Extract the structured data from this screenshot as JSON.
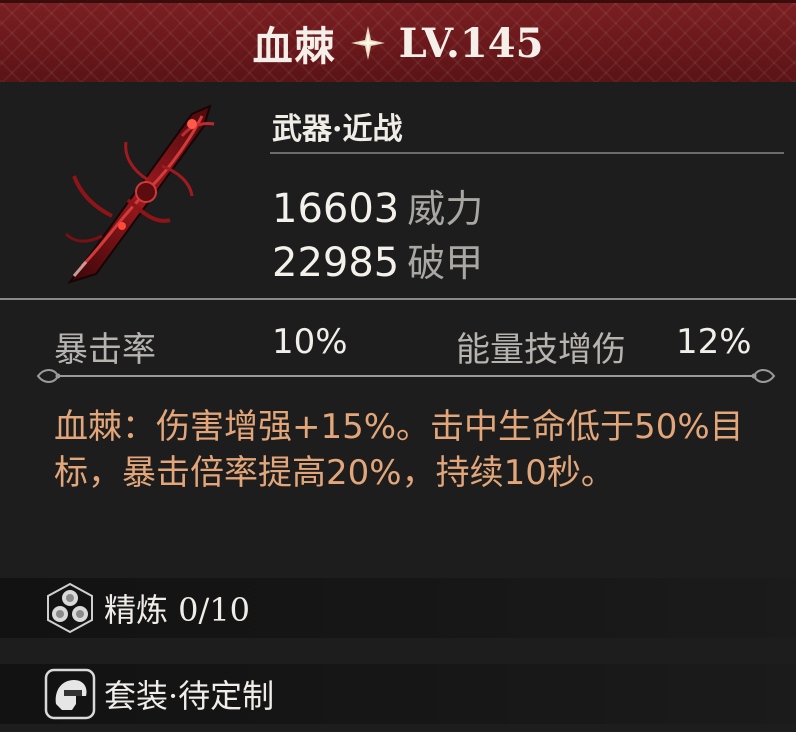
{
  "header": {
    "name": "血棘",
    "star_icon": "four-point-star-icon",
    "level": "LV.145",
    "colors": {
      "banner": "#6a181b"
    }
  },
  "weapon": {
    "image_icon": "crimson-thorn-blade-icon",
    "category": "武器·近战"
  },
  "main_stats": [
    {
      "value": "16603",
      "name": "威力"
    },
    {
      "value": "22985",
      "name": "破甲"
    }
  ],
  "sub_stats": [
    {
      "label": "暴击率",
      "value": "10%"
    },
    {
      "label": "能量技增伤",
      "value": "12%"
    }
  ],
  "description": "血棘：伤害增强+15%。击中生命低于50%目标，暴击倍率提高20%，持续10秒。",
  "description_color": "#e2a67a",
  "refine": {
    "icon": "hexagon-cluster-icon",
    "label": "精炼 0/10"
  },
  "set": {
    "icon": "helmet-icon",
    "label": "套装·待定制"
  }
}
